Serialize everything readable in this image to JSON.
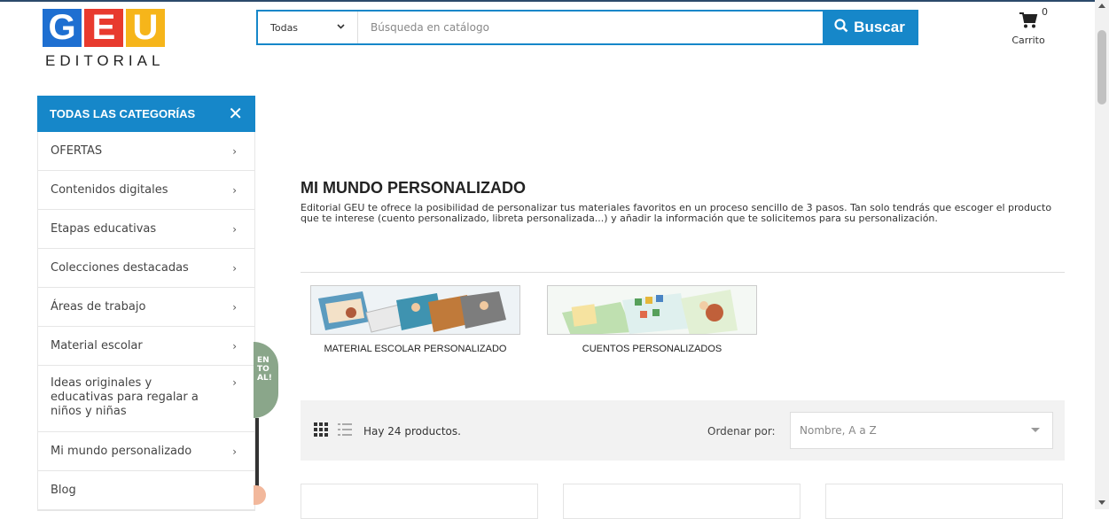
{
  "logo": {
    "letters": [
      "G",
      "E",
      "U"
    ],
    "word": "EDITORIAL"
  },
  "search": {
    "category": "Todas",
    "placeholder": "Búsqueda en catálogo",
    "button_label": "Buscar"
  },
  "cart": {
    "count": "0",
    "label": "Carrito"
  },
  "sidebar": {
    "title": "TODAS LAS CATEGORÍAS",
    "items": [
      {
        "label": "OFERTAS"
      },
      {
        "label": "Contenidos digitales"
      },
      {
        "label": "Etapas educativas"
      },
      {
        "label": "Colecciones destacadas"
      },
      {
        "label": "Áreas de trabajo"
      },
      {
        "label": "Material escolar"
      },
      {
        "label": "Ideas originales y educativas para regalar a niños y niñas"
      },
      {
        "label": "Mi mundo personalizado"
      },
      {
        "label": "Blog"
      }
    ]
  },
  "badge": {
    "text": "EN TO AL!"
  },
  "main": {
    "title": "MI MUNDO PERSONALIZADO",
    "description": "Editorial GEU te ofrece la posibilidad de personalizar tus materiales favoritos en un proceso sencillo de 3 pasos. Tan solo tendrás que escoger el producto que te interese (cuento personalizado, libreta personalizada...) y añadir la información que te solicitemos para su personalización.",
    "subcategories": [
      {
        "label": "MATERIAL ESCOLAR PERSONALIZADO"
      },
      {
        "label": "CUENTOS PERSONALIZADOS"
      }
    ]
  },
  "toolbar": {
    "product_count": "Hay 24 productos.",
    "sort_label": "Ordenar por:",
    "sort_value": "Nombre, A a Z"
  },
  "colors": {
    "accent": "#1687c9",
    "logo_blue": "#1e6fd1",
    "logo_red": "#e83a2e",
    "logo_yellow": "#f6b51a"
  }
}
